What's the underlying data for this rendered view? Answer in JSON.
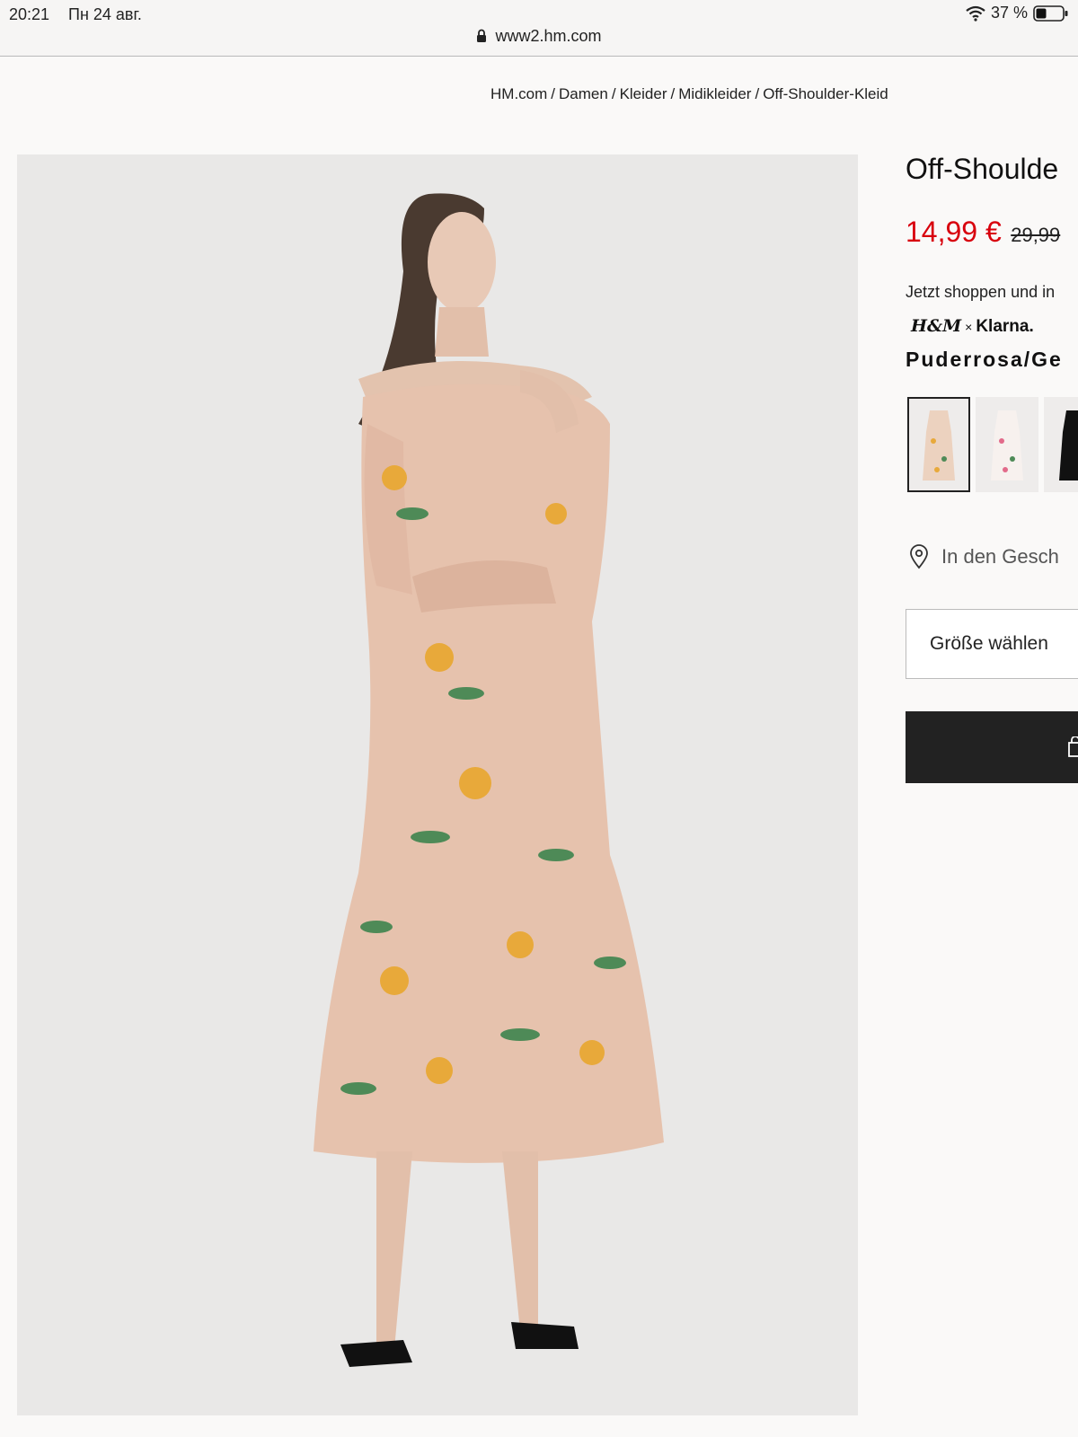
{
  "status_bar": {
    "time": "20:21",
    "date": "Пн 24 авг.",
    "battery": "37 %",
    "url": "www2.hm.com"
  },
  "breadcrumb": [
    "HM.com",
    "Damen",
    "Kleider",
    "Midikleider",
    "Off-Shoulder-Kleid"
  ],
  "product": {
    "title": "Off-Shoulde",
    "price_now": "14,99 €",
    "price_old": "29,99",
    "klarna_text": "Jetzt shoppen und in",
    "klarna_brand": "H&M",
    "klarna_x": "×",
    "klarna_name": "Klarna.",
    "color_name": "Puderrosa/Ge",
    "swatches": [
      "rose floral dress",
      "white floral dress",
      "black dress"
    ],
    "store_text": "In den Gesch",
    "size_label": "Größe wählen"
  },
  "colors": {
    "price_red": "#d8000d",
    "button_dark": "#222222"
  }
}
